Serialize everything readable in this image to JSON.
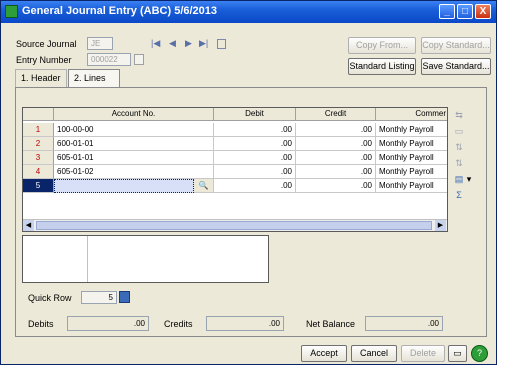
{
  "window": {
    "title": "General Journal Entry (ABC) 5/6/2013",
    "minimize_glyph": "_",
    "maximize_glyph": "□",
    "close_glyph": "X"
  },
  "header": {
    "source_journal_label": "Source Journal",
    "source_journal_value": "JE",
    "entry_number_label": "Entry Number",
    "entry_number_value": "000022",
    "nav_first": "|◀",
    "nav_prev": "◀",
    "nav_next": "▶",
    "nav_last": "▶|",
    "copy_from_label": "Copy From...",
    "copy_standard_label": "Copy Standard...",
    "standard_listing_label": "Standard Listing",
    "save_standard_label": "Save Standard..."
  },
  "tabs": [
    {
      "label": "1. Header"
    },
    {
      "label": "2. Lines"
    }
  ],
  "grid": {
    "columns": [
      "Account No.",
      "Debit",
      "Credit",
      "Commer"
    ],
    "rows": [
      {
        "num": "1",
        "account": "100-00-00",
        "debit": ".00",
        "credit": ".00",
        "comment": "Monthly Payroll"
      },
      {
        "num": "2",
        "account": "600-01-01",
        "debit": ".00",
        "credit": ".00",
        "comment": "Monthly Payroll"
      },
      {
        "num": "3",
        "account": "605-01-01",
        "debit": ".00",
        "credit": ".00",
        "comment": "Monthly Payroll"
      },
      {
        "num": "4",
        "account": "605-01-02",
        "debit": ".00",
        "credit": ".00",
        "comment": "Monthly Payroll"
      },
      {
        "num": "5",
        "account": "",
        "debit": ".00",
        "credit": ".00",
        "comment": "Monthly Payroll"
      }
    ]
  },
  "quick_row": {
    "label": "Quick Row",
    "value": "5"
  },
  "totals": {
    "debits_label": "Debits",
    "debits_value": ".00",
    "credits_label": "Credits",
    "credits_value": ".00",
    "net_balance_label": "Net Balance",
    "net_balance_value": ".00"
  },
  "footer": {
    "accept_label": "Accept",
    "cancel_label": "Cancel",
    "delete_label": "Delete"
  },
  "colors": {
    "titlebar": "#1a5ed8",
    "selected_row": "#0a246a",
    "row_number": "#c00000",
    "window_bg": "#ece9d8"
  }
}
